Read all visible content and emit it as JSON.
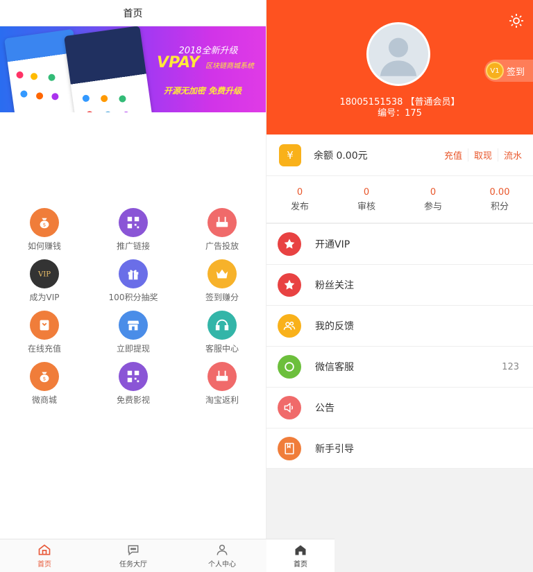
{
  "left": {
    "title": "首页",
    "banner": {
      "line1": "2018全新升级",
      "brand": "VPAY",
      "subtitle": "区块链商城系统",
      "slogan": "开源无加密 免费升级"
    },
    "grid": [
      {
        "label": "如何赚钱",
        "icon": "money-bag-icon",
        "color": "#f07d3a"
      },
      {
        "label": "推广链接",
        "icon": "qr-code-icon",
        "color": "#8a55d6"
      },
      {
        "label": "广告投放",
        "icon": "router-icon",
        "color": "#f06a6a"
      },
      {
        "label": "成为VIP",
        "icon": "vip-icon",
        "color": "#333333"
      },
      {
        "label": "100积分抽奖",
        "icon": "gift-icon",
        "color": "#6a6ee8"
      },
      {
        "label": "签到赚分",
        "icon": "crown-icon",
        "color": "#f7b22a"
      },
      {
        "label": "在线充值",
        "icon": "recharge-icon",
        "color": "#f07d3a"
      },
      {
        "label": "立即提现",
        "icon": "store-icon",
        "color": "#4a8de8"
      },
      {
        "label": "客服中心",
        "icon": "headset-icon",
        "color": "#33b5a8"
      },
      {
        "label": "微商城",
        "icon": "money-bag-icon",
        "color": "#f07d3a"
      },
      {
        "label": "免费影视",
        "icon": "qr-code-icon",
        "color": "#8a55d6"
      },
      {
        "label": "淘宝返利",
        "icon": "router-icon",
        "color": "#f06a6a"
      }
    ],
    "nav": [
      {
        "label": "首页",
        "icon": "home-icon"
      },
      {
        "label": "任务大厅",
        "icon": "chat-icon"
      },
      {
        "label": "个人中心",
        "icon": "user-icon"
      }
    ]
  },
  "right": {
    "accent": "#fe5220",
    "profile": {
      "phone": "18005151538 【普通会员】",
      "number": "编号：175",
      "level": "V1",
      "signin": "签到"
    },
    "balance": {
      "text": "余额 0.00元",
      "actions": [
        "充值",
        "取现",
        "流水"
      ]
    },
    "stats": [
      {
        "value": "0",
        "label": "发布"
      },
      {
        "value": "0",
        "label": "审核"
      },
      {
        "value": "0",
        "label": "参与"
      },
      {
        "value": "0.00",
        "label": "积分"
      }
    ],
    "menu": [
      {
        "label": "开通VIP",
        "value": "",
        "icon": "star-icon",
        "color": "#e84242"
      },
      {
        "label": "粉丝关注",
        "value": "",
        "icon": "star-icon",
        "color": "#e84242"
      },
      {
        "label": "我的反馈",
        "value": "",
        "icon": "users-icon",
        "color": "#f9b11a"
      },
      {
        "label": "微信客服",
        "value": "123",
        "icon": "circle-icon",
        "color": "#6cbf3c"
      },
      {
        "label": "公告",
        "value": "",
        "icon": "speaker-icon",
        "color": "#f06a6a"
      },
      {
        "label": "新手引导",
        "value": "",
        "icon": "book-icon",
        "color": "#f07d3a"
      }
    ],
    "nav": {
      "label": "首页",
      "icon": "home-icon"
    }
  }
}
